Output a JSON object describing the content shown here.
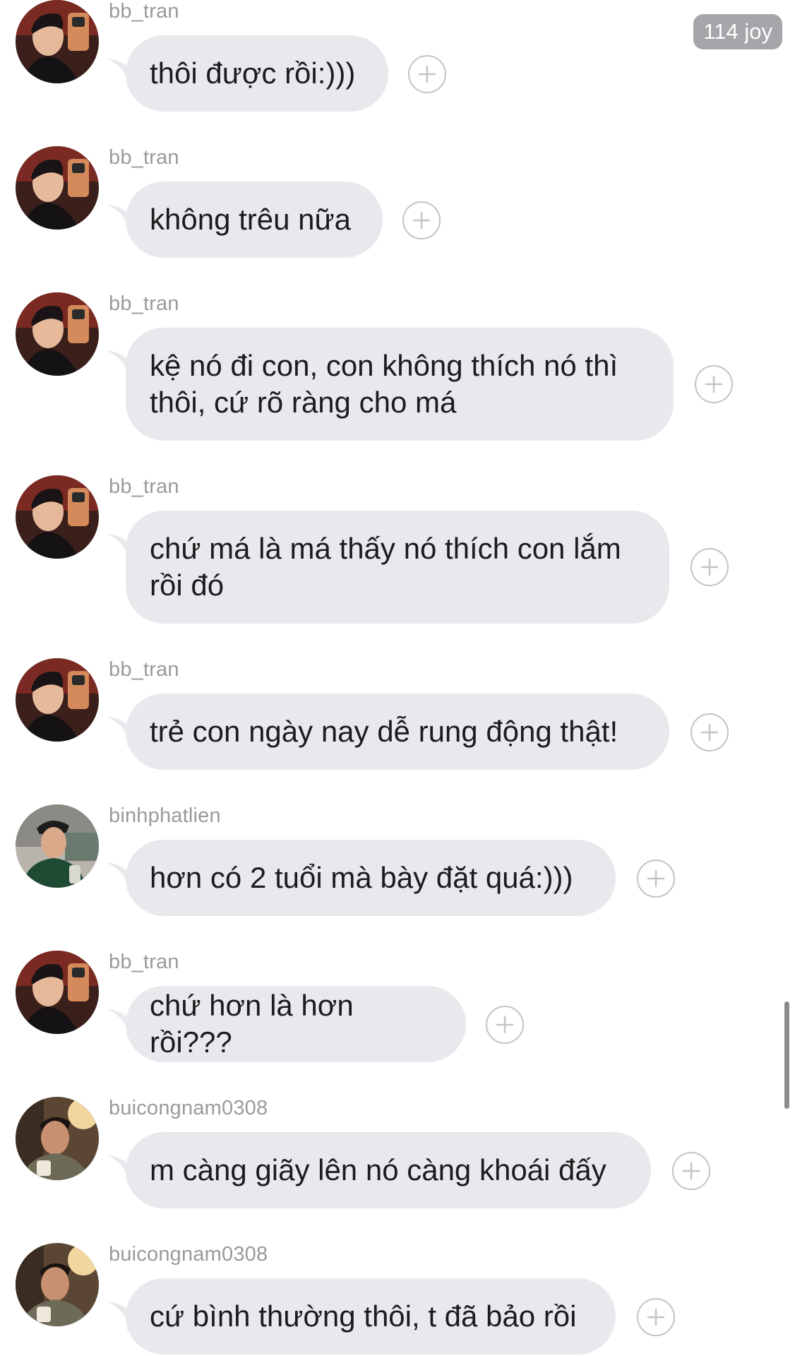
{
  "badge": {
    "text": "114 joy"
  },
  "messages": [
    {
      "username": "bb_tran",
      "text": "thôi được rồi:)))",
      "avatar": "avatar-bb-tran"
    },
    {
      "username": "bb_tran",
      "text": "không trêu nữa",
      "avatar": "avatar-bb-tran"
    },
    {
      "username": "bb_tran",
      "text": "kệ nó đi con, con không thích nó thì thôi, cứ rõ ràng cho má",
      "lines": [
        "kệ nó đi con, con không thích nó thì",
        "thôi, cứ rõ ràng cho má"
      ],
      "avatar": "avatar-bb-tran"
    },
    {
      "username": "bb_tran",
      "text": "chứ má là má thấy nó thích con lắm rồi đó",
      "lines": [
        "chứ má là má thấy nó thích con lắm",
        "rồi đó"
      ],
      "avatar": "avatar-bb-tran"
    },
    {
      "username": "bb_tran",
      "text": "trẻ con ngày nay dễ rung động thật!",
      "avatar": "avatar-bb-tran"
    },
    {
      "username": "binhphatlien",
      "text": "hơn có 2 tuổi mà bày đặt quá:)))",
      "avatar": "avatar-binhphatlien"
    },
    {
      "username": "bb_tran",
      "text": "chứ hơn là hơn rồi???",
      "avatar": "avatar-bb-tran"
    },
    {
      "username": "buicongnam0308",
      "text": "m càng giãy lên nó càng khoái đấy",
      "avatar": "avatar-buicongnam0308"
    },
    {
      "username": "buicongnam0308",
      "text": "cứ bình thường thôi, t đã bảo rồi",
      "avatar": "avatar-buicongnam0308"
    }
  ],
  "icons": {
    "add_reaction": "plus-circle-icon"
  },
  "colors": {
    "bubble": "#e8e9ec",
    "username": "#9a9a9e",
    "text": "#1c1c1e",
    "badge": "#a6a6aa"
  }
}
